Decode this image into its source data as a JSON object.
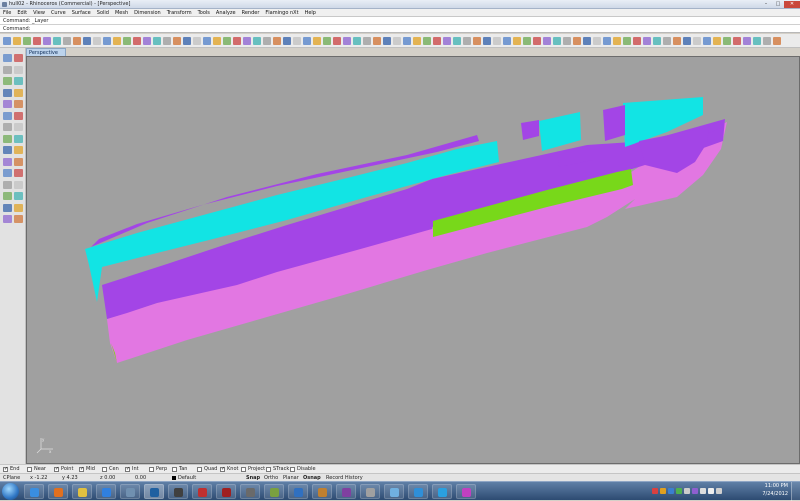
{
  "window": {
    "title": "hull02 - Rhinoceros (Commercial) - [Perspective]",
    "controls": [
      "–",
      "□",
      "✕"
    ]
  },
  "menu": [
    "File",
    "Edit",
    "View",
    "Curve",
    "Surface",
    "Solid",
    "Mesh",
    "Dimension",
    "Transform",
    "Tools",
    "Analyze",
    "Render",
    "Flamingo nXt",
    "Help"
  ],
  "command": {
    "history": "Command: _Layer",
    "prompt": "Command:"
  },
  "toolbar_icons": [
    "new-icon",
    "open-icon",
    "save-icon",
    "print-icon",
    "import-icon",
    "cut-icon",
    "copy-icon",
    "paste-icon",
    "undo-icon",
    "redo-icon",
    "pan-icon",
    "rotate-view-icon",
    "zoom-icon",
    "zoom-window-icon",
    "zoom-extents-icon",
    "zoom-selected-icon",
    "zoom-target-icon",
    "zoom-all-icon",
    "undo-view-icon",
    "named-views-icon",
    "car-icon",
    "construction-plane-icon",
    "four-views-icon",
    "select-all-icon",
    "layers-icon",
    "light-icon",
    "properties-icon",
    "wireframe-icon",
    "shaded-icon",
    "rendered-icon",
    "render-icon",
    "material-icon",
    "camera-icon",
    "help-icon",
    "toolbar-icon-35",
    "toolbar-icon-36",
    "toolbar-icon-37",
    "toolbar-icon-38",
    "toolbar-icon-39",
    "toolbar-icon-40",
    "toolbar-icon-41",
    "toolbar-icon-42",
    "toolbar-icon-43",
    "toolbar-icon-44",
    "toolbar-icon-45",
    "toolbar-icon-46",
    "toolbar-icon-47",
    "toolbar-icon-48",
    "toolbar-icon-49",
    "toolbar-icon-50",
    "toolbar-icon-51",
    "toolbar-icon-52",
    "toolbar-icon-53",
    "toolbar-icon-54",
    "toolbar-icon-55",
    "toolbar-icon-56",
    "toolbar-icon-57",
    "toolbar-icon-58",
    "toolbar-icon-59",
    "toolbar-icon-60",
    "toolbar-icon-61",
    "toolbar-icon-62",
    "toolbar-icon-63",
    "toolbar-icon-64",
    "toolbar-icon-65",
    "toolbar-icon-66",
    "toolbar-icon-67",
    "toolbar-icon-68",
    "toolbar-icon-69",
    "toolbar-icon-70",
    "toolbar-icon-71",
    "toolbar-icon-72",
    "toolbar-icon-73",
    "toolbar-icon-74",
    "toolbar-icon-75",
    "toolbar-icon-76",
    "toolbar-icon-77",
    "toolbar-icon-78"
  ],
  "sidebar_icons": [
    "select-icon",
    "point-icon",
    "polyline-icon",
    "curve-icon",
    "circle-icon",
    "arc-icon",
    "ellipse-icon",
    "rectangle-icon",
    "polygon-icon",
    "free-curve-icon",
    "surface-icon",
    "loft-icon",
    "box-icon",
    "sphere-icon",
    "cylinder-icon",
    "extrude-icon",
    "boolean-icon",
    "fillet-icon",
    "mesh-icon",
    "dimension-icon",
    "trim-icon",
    "split-icon",
    "join-icon",
    "explode-icon",
    "move-icon",
    "rotate-icon",
    "scale-icon",
    "mirror-icon",
    "array-icon",
    "analyze-icon"
  ],
  "viewport": {
    "tab_label": "Perspective",
    "axis_labels": [
      "y",
      "x"
    ]
  },
  "osnaps": [
    {
      "label": "End",
      "checked": true
    },
    {
      "label": "Near",
      "checked": false
    },
    {
      "label": "Point",
      "checked": true
    },
    {
      "label": "Mid",
      "checked": true
    },
    {
      "label": "Cen",
      "checked": false
    },
    {
      "label": "Int",
      "checked": true
    },
    {
      "label": "Perp",
      "checked": false
    },
    {
      "label": "Tan",
      "checked": false
    },
    {
      "label": "Quad",
      "checked": false
    },
    {
      "label": "Knot",
      "checked": true
    },
    {
      "label": "Project",
      "checked": false
    },
    {
      "label": "STrack",
      "checked": false
    },
    {
      "label": "Disable",
      "checked": false
    }
  ],
  "status": {
    "cplane": "CPlane",
    "x": "x -1.22",
    "y": "y 4.23",
    "z": "z 0.00",
    "units": "0.00",
    "layer": "Default",
    "toggles": [
      "Snap",
      "Ortho",
      "Planar",
      "Osnap",
      "Record History"
    ]
  },
  "taskbar": {
    "apps": [
      "ie-icon",
      "firefox-icon",
      "explorer-icon",
      "media-player-icon",
      "rhino-icon",
      "photoshop-icon",
      "grasshopper-icon",
      "skype-call-icon",
      "onenote-icon",
      "app-icon-10",
      "app-icon-11",
      "app-icon-12",
      "app-icon-13",
      "app-icon-14",
      "app-icon-15",
      "app-icon-16",
      "app-icon-17",
      "skype-icon",
      "app-icon-19"
    ],
    "time": "11:00 PM",
    "date": "7/24/2012"
  },
  "colors": {
    "hull_magenta": "#e277e2",
    "hull_purple": "#a345e6",
    "hull_cyan": "#12e4e4",
    "hull_green": "#78d81a",
    "viewport_bg": "#a0a0a0"
  }
}
